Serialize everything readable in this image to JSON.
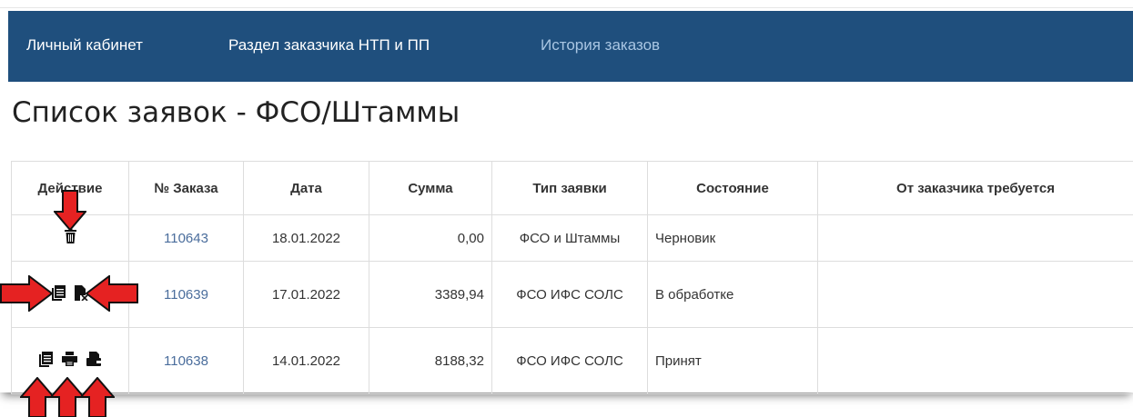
{
  "nav": {
    "items": [
      {
        "label": "Личный кабинет"
      },
      {
        "label": "Раздел заказчика НТП и ПП"
      },
      {
        "label": "История заказов"
      }
    ]
  },
  "page": {
    "title": "Список заявок - ФСО/Штаммы"
  },
  "table": {
    "headers": {
      "action": "Действие",
      "number": "№ Заказа",
      "date": "Дата",
      "sum": "Сумма",
      "type": "Тип заявки",
      "state": "Состояние",
      "required": "От заказчика требуется"
    },
    "rows": [
      {
        "number": "110643",
        "date": "18.01.2022",
        "sum": "0,00",
        "type": "ФСО и Штаммы",
        "state": "Черновик",
        "required": "",
        "actions": [
          "trash-icon"
        ]
      },
      {
        "number": "110639",
        "date": "17.01.2022",
        "sum": "3389,94",
        "type": "ФСО ИФС СОЛС",
        "state": "В обработке",
        "required": "",
        "actions": [
          "copy-icon",
          "cancel-document-icon"
        ]
      },
      {
        "number": "110638",
        "date": "14.01.2022",
        "sum": "8188,32",
        "type": "ФСО ИФС СОЛС",
        "state": "Принят",
        "required": "",
        "actions": [
          "copy-icon",
          "print-icon",
          "payment-icon"
        ]
      }
    ]
  },
  "colors": {
    "navbar": "#1f4f7d",
    "nav_text": "#ffffff",
    "nav_muted": "#a9c6e3",
    "link": "#4a6d9c",
    "arrow": "#e52222"
  },
  "annotations": {
    "arrow_icon": "red-arrow-icon"
  }
}
